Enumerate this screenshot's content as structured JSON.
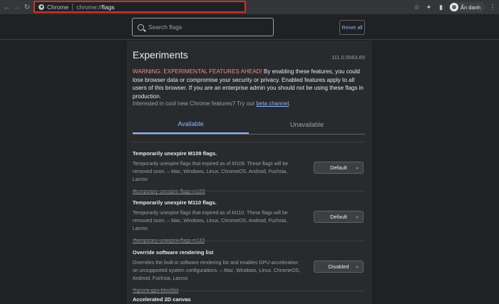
{
  "toolbar": {
    "back_icon": "back-arrow-icon",
    "forward_icon": "forward-arrow-icon",
    "reload_icon": "reload-icon",
    "omnibox": {
      "site_label": "Chrome",
      "scheme": "chrome://",
      "path": "flags"
    },
    "profile_name": "Ẩn danh"
  },
  "header": {
    "search_placeholder": "Search flags",
    "reset_label": "Reset all"
  },
  "page": {
    "title": "Experiments",
    "version": "111.0.5563.65",
    "warning_prefix": "WARNING: EXPERIMENTAL FEATURES AHEAD!",
    "warning_body": " By enabling these features, you could lose browser data or compromise your security or privacy. Enabled features apply to all users of this browser. If you are an enterprise admin you should not be using these flags in production.",
    "interest_text": "Interested in cool new Chrome features? Try our ",
    "interest_link": "beta channel",
    "interest_end": "."
  },
  "tabs": [
    {
      "label": "Available",
      "active": true
    },
    {
      "label": "Unavailable",
      "active": false
    }
  ],
  "flags": [
    {
      "name": "Temporarily unexpire M109 flags.",
      "description": "Temporarily unexpire flags that expired as of M109. These flags will be removed soon. – Mac, Windows, Linux, ChromeOS, Android, Fuchsia, Lacros",
      "link": "#temporary-unexpire-flags-m109",
      "value": "Default"
    },
    {
      "name": "Temporarily unexpire M110 flags.",
      "description": "Temporarily unexpire flags that expired as of M110. These flags will be removed soon. – Mac, Windows, Linux, ChromeOS, Android, Fuchsia, Lacros",
      "link": "#temporary-unexpire-flags-m110",
      "value": "Default"
    },
    {
      "name": "Override software rendering list",
      "description": "Overrides the built-in software rendering list and enables GPU-acceleration on unsupported system configurations. – Mac, Windows, Linux, ChromeOS, Android, Fuchsia, Lacros",
      "link": "#ignore-gpu-blocklist",
      "value": "Disabled"
    },
    {
      "name": "Accelerated 2D canvas"
    }
  ],
  "colors": {
    "accent": "#8ab4f8",
    "warning": "#f28b82",
    "highlight_box": "#d93025"
  }
}
